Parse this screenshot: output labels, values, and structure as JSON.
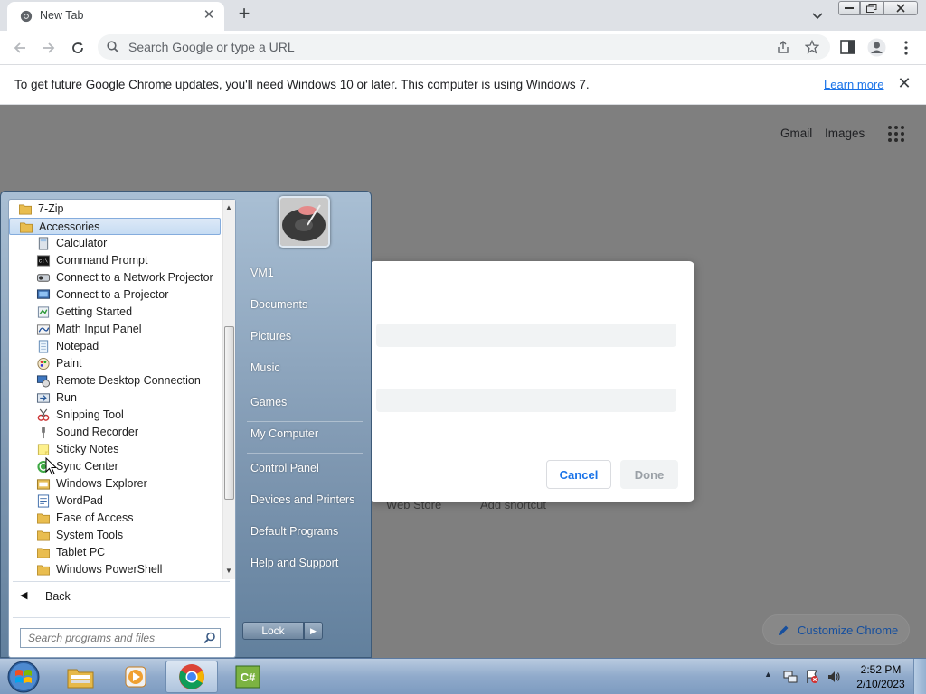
{
  "browser": {
    "tab_title": "New Tab",
    "omnibox_placeholder": "Search Google or type a URL",
    "infobar": {
      "message": "To get future Google Chrome updates, you'll need Windows 10 or later. This computer is using Windows 7.",
      "link": "Learn more"
    },
    "ntp": {
      "gmail": "Gmail",
      "images": "Images",
      "shortcut_web_store": "Web Store",
      "shortcut_add": "Add shortcut",
      "customize": "Customize Chrome"
    },
    "dialog": {
      "cancel": "Cancel",
      "done": "Done"
    }
  },
  "startmenu": {
    "programs": [
      {
        "label": "7-Zip",
        "icon": "folder-icon",
        "indent": 0
      },
      {
        "label": "Accessories",
        "icon": "folder-icon",
        "indent": 0,
        "selected": true
      },
      {
        "label": "Calculator",
        "icon": "calculator-icon",
        "indent": 1
      },
      {
        "label": "Command Prompt",
        "icon": "command-prompt-icon",
        "indent": 1
      },
      {
        "label": "Connect to a Network Projector",
        "icon": "network-projector-icon",
        "indent": 1
      },
      {
        "label": "Connect to a Projector",
        "icon": "projector-icon",
        "indent": 1
      },
      {
        "label": "Getting Started",
        "icon": "getting-started-icon",
        "indent": 1
      },
      {
        "label": "Math Input Panel",
        "icon": "math-input-icon",
        "indent": 1
      },
      {
        "label": "Notepad",
        "icon": "notepad-icon",
        "indent": 1
      },
      {
        "label": "Paint",
        "icon": "paint-icon",
        "indent": 1
      },
      {
        "label": "Remote Desktop Connection",
        "icon": "remote-desktop-icon",
        "indent": 1
      },
      {
        "label": "Run",
        "icon": "run-icon",
        "indent": 1
      },
      {
        "label": "Snipping Tool",
        "icon": "snipping-tool-icon",
        "indent": 1
      },
      {
        "label": "Sound Recorder",
        "icon": "microphone-icon",
        "indent": 1
      },
      {
        "label": "Sticky Notes",
        "icon": "sticky-notes-icon",
        "indent": 1
      },
      {
        "label": "Sync Center",
        "icon": "sync-center-icon",
        "indent": 1
      },
      {
        "label": "Windows Explorer",
        "icon": "explorer-icon",
        "indent": 1
      },
      {
        "label": "WordPad",
        "icon": "wordpad-icon",
        "indent": 1
      },
      {
        "label": "Ease of Access",
        "icon": "folder-icon",
        "indent": 1
      },
      {
        "label": "System Tools",
        "icon": "folder-icon",
        "indent": 1
      },
      {
        "label": "Tablet PC",
        "icon": "folder-icon",
        "indent": 1
      },
      {
        "label": "Windows PowerShell",
        "icon": "folder-icon",
        "indent": 1
      }
    ],
    "back": "Back",
    "search_placeholder": "Search programs and files",
    "right_items": [
      {
        "label": "VM1"
      },
      {
        "label": "Documents"
      },
      {
        "label": "Pictures"
      },
      {
        "label": "Music"
      },
      {
        "label": "Games"
      },
      {
        "label": "My Computer"
      },
      {
        "label": "Control Panel"
      },
      {
        "label": "Devices and Printers"
      },
      {
        "label": "Default Programs"
      },
      {
        "label": "Help and Support"
      }
    ],
    "lock": "Lock"
  },
  "taskbar": {
    "apps": [
      "windows-explorer",
      "media-player",
      "chrome",
      "csharp-editor"
    ],
    "active_app": "chrome",
    "time": "2:52 PM",
    "date": "2/10/2023"
  },
  "colors": {
    "chrome_blue": "#1a73e8",
    "startmenu_blue": "#7d96b0",
    "taskbar_blue": "#90aacb"
  }
}
